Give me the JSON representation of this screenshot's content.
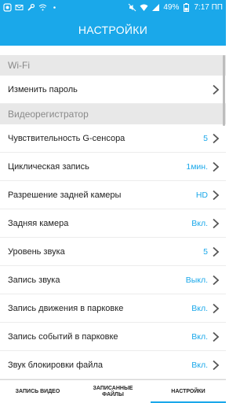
{
  "status_bar": {
    "battery": "49%",
    "time": "7:17 ПП"
  },
  "header": {
    "title": "НАСТРОЙКИ"
  },
  "sections": [
    {
      "title": "Wi-Fi",
      "items": [
        {
          "label": "Изменить пароль",
          "value": ""
        }
      ]
    },
    {
      "title": "Видеорегистратор",
      "items": [
        {
          "label": "Чувствительность G-сенсора",
          "value": "5"
        },
        {
          "label": "Циклическая запись",
          "value": "1мин."
        },
        {
          "label": "Разрешение задней камеры",
          "value": "HD"
        },
        {
          "label": "Задняя камера",
          "value": "Вкл."
        },
        {
          "label": "Уровень звука",
          "value": "5"
        },
        {
          "label": "Запись звука",
          "value": "Выкл."
        },
        {
          "label": "Запись движения в парковке",
          "value": "Вкл."
        },
        {
          "label": "Запись событий в парковке",
          "value": "Вкл."
        },
        {
          "label": "Звук блокировки файла",
          "value": "Вкл."
        }
      ]
    }
  ],
  "bottom_nav": {
    "tabs": [
      {
        "label": "ЗАПИСЬ ВИДЕО",
        "active": false
      },
      {
        "label": "ЗАПИСАННЫЕ ФАЙЛЫ",
        "active": false
      },
      {
        "label": "НАСТРОЙКИ",
        "active": true
      }
    ]
  },
  "colors": {
    "accent": "#1aa8ea",
    "section_bg": "#e8e8e8",
    "section_text": "#8a8a8a"
  }
}
